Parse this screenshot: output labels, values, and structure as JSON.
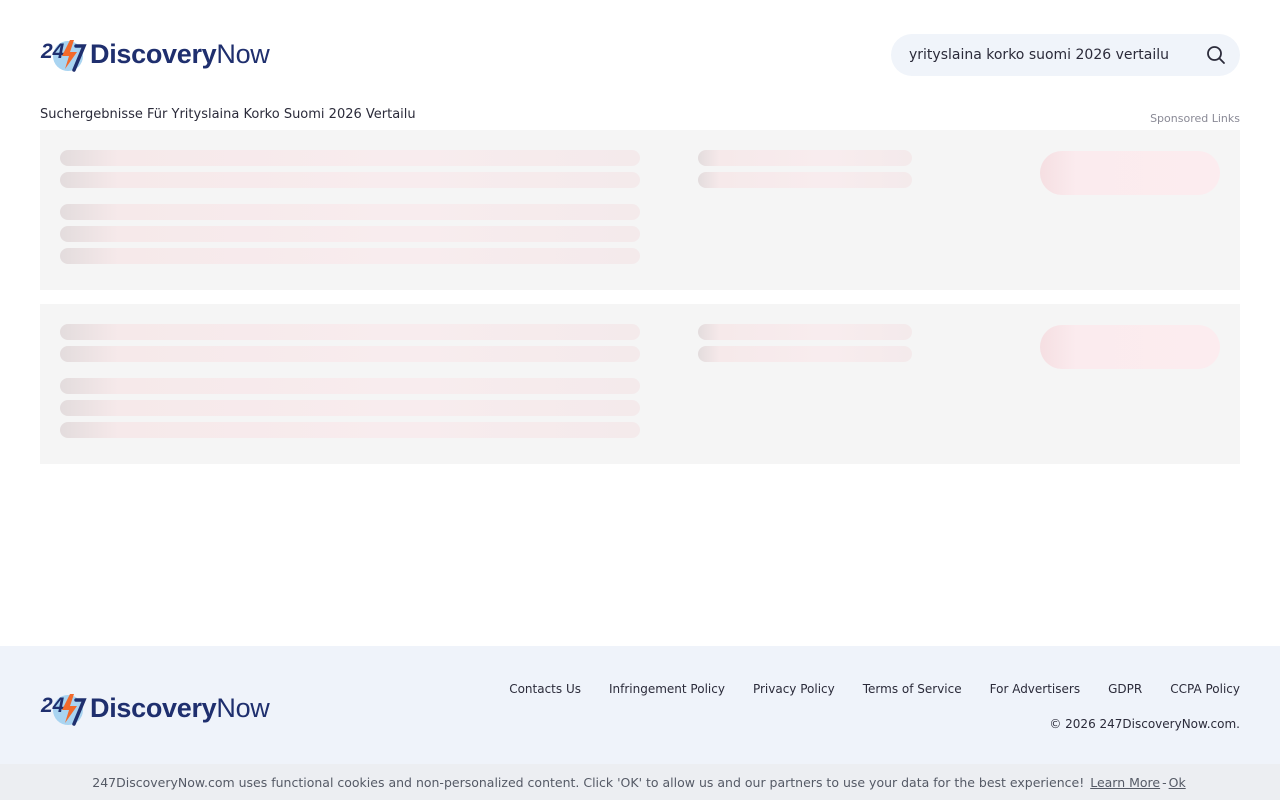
{
  "brand": {
    "logo_number": "24/7",
    "logo_word_bold": "Discovery",
    "logo_word_regular": "Now",
    "colors": {
      "navy": "#1f2f6e",
      "orange": "#f26a2b",
      "sky": "#a9d4f1"
    }
  },
  "search": {
    "value": "yrityslaina korko suomi 2026 vertailu",
    "button_icon": "search-icon"
  },
  "results": {
    "title": "Suchergebnisse Für Yrityslaina Korko Suomi 2026 Vertailu",
    "sponsored_label": "Sponsored Links",
    "placeholder_cards": 2
  },
  "footer": {
    "links": [
      "Contacts Us",
      "Infringement Policy",
      "Privacy Policy",
      "Terms of Service",
      "For Advertisers",
      "GDPR",
      "CCPA Policy"
    ],
    "copyright": "© 2026 247DiscoveryNow.com."
  },
  "cookie_bar": {
    "text": "247DiscoveryNow.com uses functional cookies and non-personalized content. Click 'OK' to allow us and our partners to use your data for the best experience!",
    "learn_more": "Learn More",
    "separator": "-",
    "ok": "Ok"
  }
}
